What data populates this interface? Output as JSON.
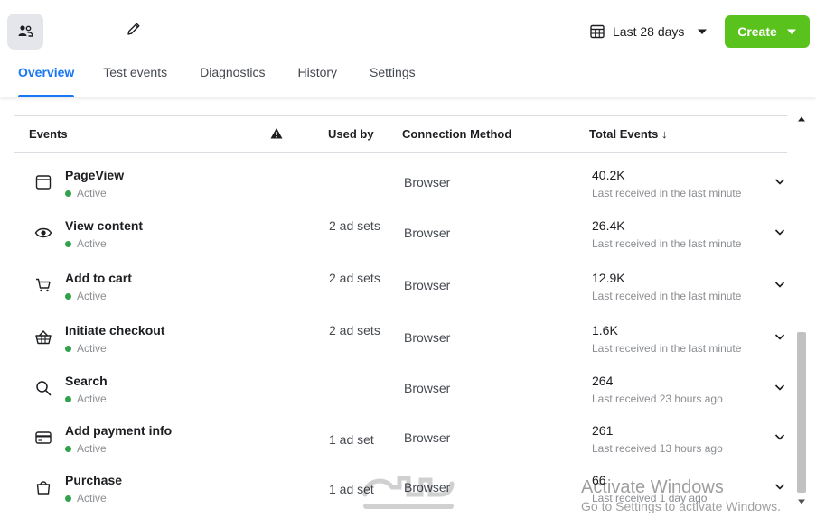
{
  "header": {
    "date_range": "Last 28 days",
    "create_label": "Create"
  },
  "tabs": [
    {
      "label": "Overview",
      "active": true
    },
    {
      "label": "Test events"
    },
    {
      "label": "Diagnostics"
    },
    {
      "label": "History"
    },
    {
      "label": "Settings"
    }
  ],
  "table": {
    "headers": {
      "events": "Events",
      "used_by": "Used by",
      "connection": "Connection Method",
      "total": "Total Events ↓"
    },
    "rows": [
      {
        "icon": "window-icon",
        "name": "PageView",
        "status": "Active",
        "used_by": "",
        "connection": "Browser",
        "total": "40.2K",
        "received": "Last received in the last minute"
      },
      {
        "icon": "eye-icon",
        "name": "View content",
        "status": "Active",
        "used_by": "2 ad sets",
        "connection": "Browser",
        "total": "26.4K",
        "received": "Last received in the last minute"
      },
      {
        "icon": "cart-icon",
        "name": "Add to cart",
        "status": "Active",
        "used_by": "2 ad sets",
        "connection": "Browser",
        "total": "12.9K",
        "received": "Last received in the last minute"
      },
      {
        "icon": "basket-icon",
        "name": "Initiate checkout",
        "status": "Active",
        "used_by": "2 ad sets",
        "connection": "Browser",
        "total": "1.6K",
        "received": "Last received in the last minute"
      },
      {
        "icon": "search-icon",
        "name": "Search",
        "status": "Active",
        "used_by": "",
        "connection": "Browser",
        "total": "264",
        "received": "Last received 23 hours ago"
      },
      {
        "icon": "credit-card-icon",
        "name": "Add payment info",
        "status": "Active",
        "used_by": "1 ad set",
        "connection": "Browser",
        "total": "261",
        "received": "Last received 13 hours ago"
      },
      {
        "icon": "bag-icon",
        "name": "Purchase",
        "status": "Active",
        "used_by": "1 ad set",
        "connection": "Browser",
        "total": "66",
        "received": "Last received 1 day ago"
      }
    ]
  },
  "overlay": {
    "activate_title": "Activate Windows",
    "activate_sub": "Go to Settings to activate Windows."
  },
  "colors": {
    "accent": "#1877f2",
    "create": "#5ac21c",
    "active_dot": "#31a24c"
  }
}
